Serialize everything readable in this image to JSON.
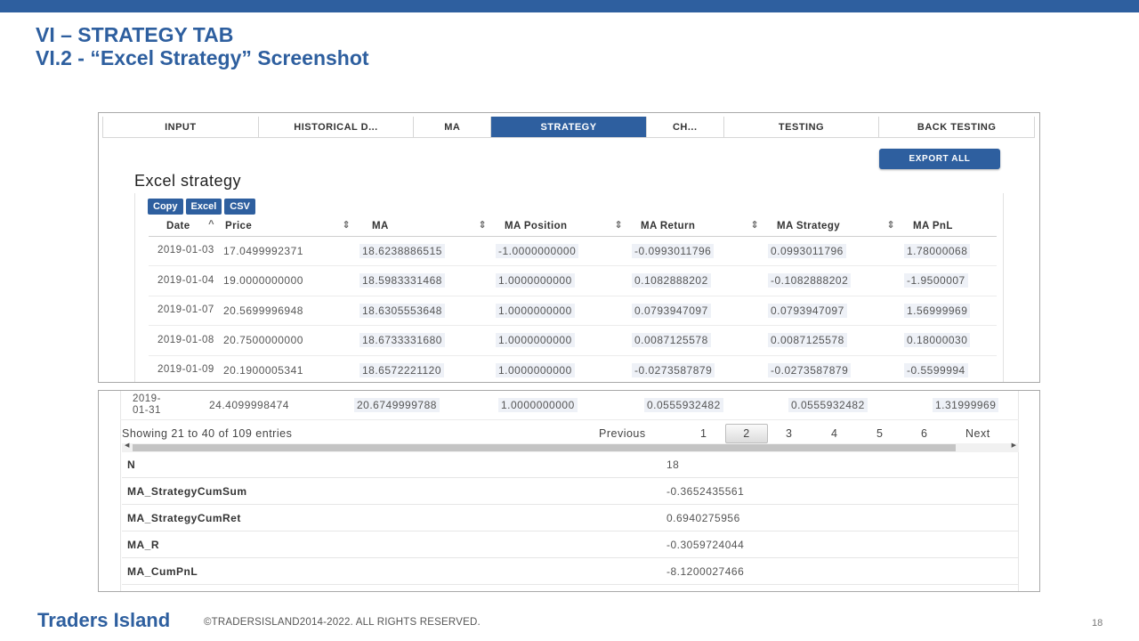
{
  "slide": {
    "title_line1": "VI – STRATEGY TAB",
    "title_line2": "VI.2 - “Excel Strategy” Screenshot",
    "footer_brand": "Traders Island",
    "footer_copy": "©TRADERSISLAND2014-2022. ALL RIGHTS RESERVED.",
    "page_number": "18",
    "accent_color": "#2e5f9f"
  },
  "tabs": [
    "INPUT",
    "HISTORICAL D...",
    "MA",
    "STRATEGY",
    "CH...",
    "TESTING",
    "BACK TESTING"
  ],
  "active_tab": "STRATEGY",
  "export_all_label": "EXPORT ALL",
  "section_title": "Excel strategy",
  "table_buttons": {
    "copy": "Copy",
    "excel": "Excel",
    "csv": "CSV"
  },
  "columns": [
    "Date",
    "Price",
    "MA",
    "MA Position",
    "MA Return",
    "MA Strategy",
    "MA PnL"
  ],
  "rows": [
    {
      "date": "2019-01-03",
      "price": "17.0499992371",
      "ma": "18.6238886515",
      "pos": "-1.0000000000",
      "ret": "-0.0993011796",
      "strat": "0.0993011796",
      "pnl": "1.78000068"
    },
    {
      "date": "2019-01-04",
      "price": "19.0000000000",
      "ma": "18.5983331468",
      "pos": "1.0000000000",
      "ret": "0.1082888202",
      "strat": "-0.1082888202",
      "pnl": "-1.9500007"
    },
    {
      "date": "2019-01-07",
      "price": "20.5699996948",
      "ma": "18.6305553648",
      "pos": "1.0000000000",
      "ret": "0.0793947097",
      "strat": "0.0793947097",
      "pnl": "1.56999969"
    },
    {
      "date": "2019-01-08",
      "price": "20.7500000000",
      "ma": "18.6733331680",
      "pos": "1.0000000000",
      "ret": "0.0087125578",
      "strat": "0.0087125578",
      "pnl": "0.18000030"
    },
    {
      "date": "2019-01-09",
      "price": "20.1900005341",
      "ma": "18.6572221120",
      "pos": "1.0000000000",
      "ret": "-0.0273587879",
      "strat": "-0.0273587879",
      "pnl": "-0.5599994"
    }
  ],
  "last_row": {
    "date": "2019-01-31",
    "price": "24.4099998474",
    "ma": "20.6749999788",
    "pos": "1.0000000000",
    "ret": "0.0555932482",
    "strat": "0.0555932482",
    "pnl": "1.31999969"
  },
  "pagination": {
    "info": "Showing 21 to 40 of 109 entries",
    "previous": "Previous",
    "pages": [
      "1",
      "2",
      "3",
      "4",
      "5",
      "6"
    ],
    "current_page": "2",
    "next": "Next"
  },
  "stats": [
    {
      "key": "N",
      "value": "18"
    },
    {
      "key": "MA_StrategyCumSum",
      "value": "-0.3652435561"
    },
    {
      "key": "MA_StrategyCumRet",
      "value": "0.6940275956"
    },
    {
      "key": "MA_R",
      "value": "-0.3059724044"
    },
    {
      "key": "MA_CumPnL",
      "value": "-8.1200027466"
    }
  ]
}
